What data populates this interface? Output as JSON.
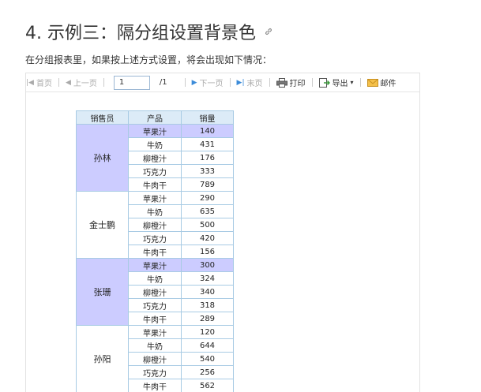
{
  "heading": "4. 示例三：隔分组设置背景色",
  "intro": "在分组报表里，如果按上述方式设置，将会出现如下情况：",
  "toolbar": {
    "first": "首页",
    "prev": "上一页",
    "page_value": "1",
    "page_total": "/1",
    "next": "下一页",
    "last": "末页",
    "print": "打印",
    "export": "导出",
    "mail": "邮件"
  },
  "table": {
    "headers": [
      "销售员",
      "产品",
      "销量"
    ],
    "groups": [
      {
        "seller": "孙林",
        "rows": [
          [
            "苹果汁",
            "140"
          ],
          [
            "牛奶",
            "431"
          ],
          [
            "柳橙汁",
            "176"
          ],
          [
            "巧克力",
            "333"
          ],
          [
            "牛肉干",
            "789"
          ]
        ]
      },
      {
        "seller": "金士鹏",
        "rows": [
          [
            "苹果汁",
            "290"
          ],
          [
            "牛奶",
            "635"
          ],
          [
            "柳橙汁",
            "500"
          ],
          [
            "巧克力",
            "420"
          ],
          [
            "牛肉干",
            "156"
          ]
        ]
      },
      {
        "seller": "张珊",
        "rows": [
          [
            "苹果汁",
            "300"
          ],
          [
            "牛奶",
            "324"
          ],
          [
            "柳橙汁",
            "340"
          ],
          [
            "巧克力",
            "318"
          ],
          [
            "牛肉干",
            "289"
          ]
        ]
      },
      {
        "seller": "孙阳",
        "rows": [
          [
            "苹果汁",
            "120"
          ],
          [
            "牛奶",
            "644"
          ],
          [
            "柳橙汁",
            "540"
          ],
          [
            "巧克力",
            "256"
          ],
          [
            "牛肉干",
            "562"
          ]
        ]
      }
    ]
  },
  "colors": {
    "group_highlight": "#ccccff",
    "header_bg": "#dcebf7",
    "border": "#a8cbe4"
  }
}
